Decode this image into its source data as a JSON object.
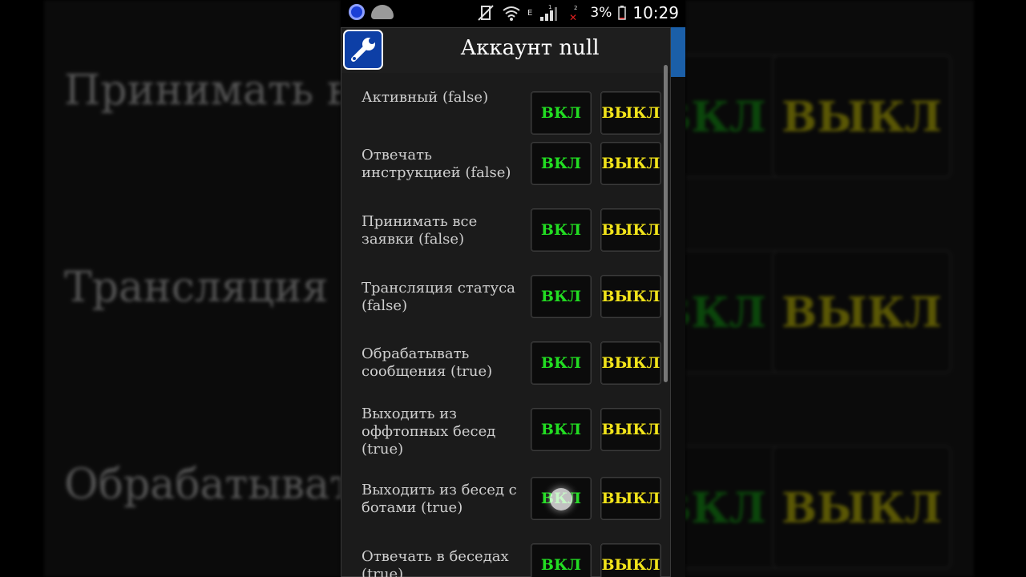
{
  "status_bar": {
    "battery": "3%",
    "time": "10:29",
    "network_type": "E",
    "sim1_label": "1",
    "sim2_label": "2"
  },
  "dialog": {
    "title": "Аккаунт null",
    "icon": "wrench-icon",
    "on_label": "ВКЛ",
    "off_label": "ВЫКЛ",
    "settings": [
      {
        "label": "Активный (false)"
      },
      {
        "label": "Отвечать инструкцией (false)"
      },
      {
        "label": "Принимать все заявки (false)"
      },
      {
        "label": "Трансляция статуса (false)"
      },
      {
        "label": "Обрабатывать сообщения (true)"
      },
      {
        "label": "Выходить из оффтопных бесед (true)"
      },
      {
        "label": "Выходить из бесед с ботами (true)"
      },
      {
        "label": "Отвечать в беседах (true)"
      }
    ]
  },
  "colors": {
    "on_text": "#22dd22",
    "off_text": "#f2e41a",
    "app_icon_bg": "#0d3fa6"
  }
}
